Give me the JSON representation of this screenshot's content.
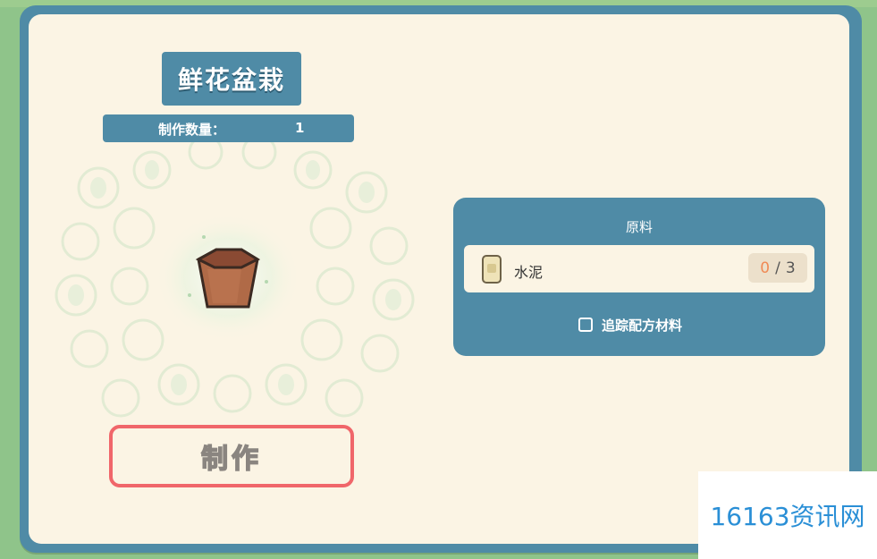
{
  "recipe": {
    "title": "鲜花盆栽",
    "quantity_label": "制作数量：",
    "quantity_value": "1",
    "craft_button": "制作"
  },
  "materials": {
    "header": "原料",
    "items": [
      {
        "name": "水泥",
        "have": "0",
        "separator": "/",
        "need": "3",
        "icon": "cement-bag-icon"
      }
    ],
    "track_label": "追踪配方材料",
    "track_checked": false
  },
  "watermark": "16163资讯网",
  "colors": {
    "frame": "#4f8ba6",
    "panel": "#fbf4e4",
    "button_border": "#f0666a",
    "have_count": "#f08a55",
    "watermark": "#2a8fd6"
  }
}
